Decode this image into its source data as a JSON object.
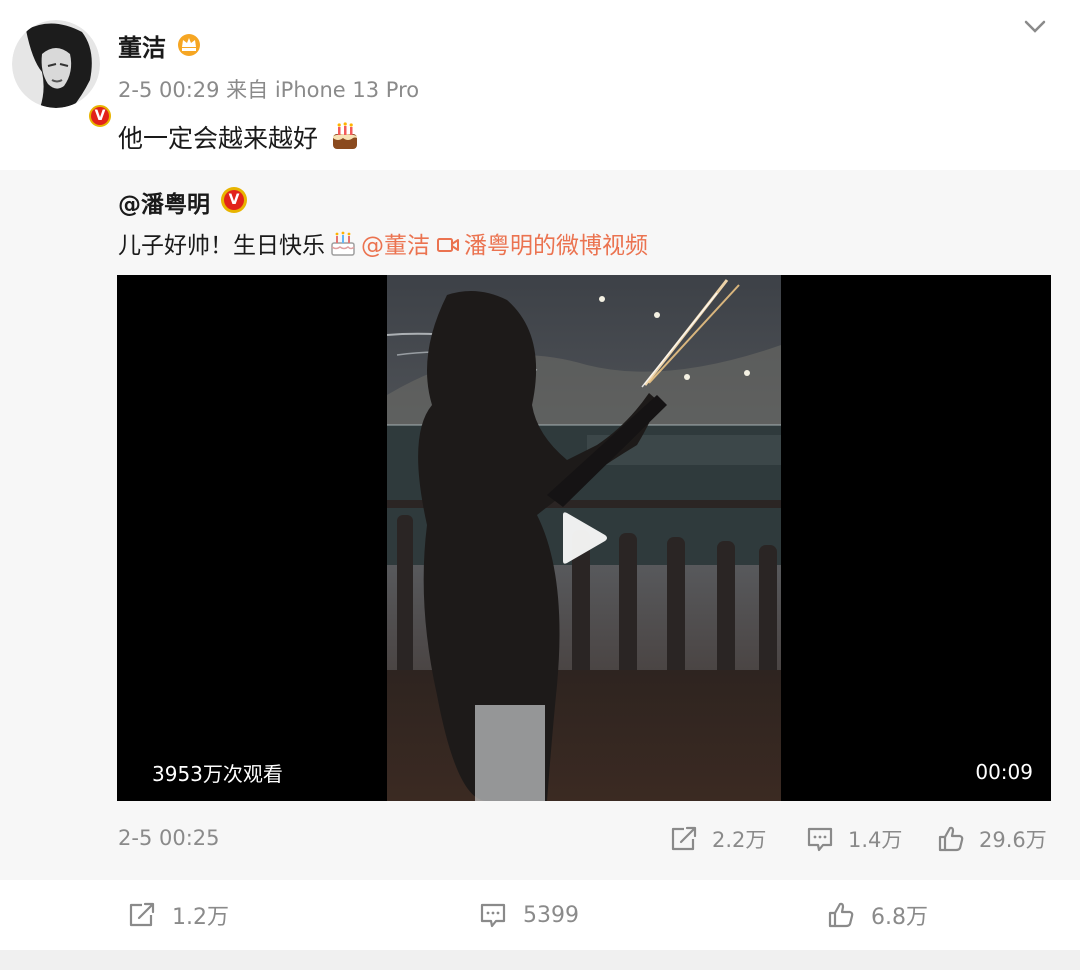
{
  "post": {
    "author": "董洁",
    "meta": "2-5 00:29  来自 iPhone 13 Pro",
    "text": "他一定会越来越好",
    "verified_mark": "V"
  },
  "repost": {
    "author": "@潘粤明",
    "verified_mark": "V",
    "text": "儿子好帅！生日快乐",
    "mention": "@董洁",
    "video_link": "潘粤明的微博视频",
    "video": {
      "views": "3953万次观看",
      "duration": "00:09"
    },
    "time": "2-5 00:25",
    "stats": {
      "shares": "2.2万",
      "comments": "1.4万",
      "likes": "29.6万"
    }
  },
  "actions": {
    "shares": "1.2万",
    "comments": "5399",
    "likes": "6.8万"
  },
  "colors": {
    "accent_link": "#eb7350",
    "muted_text": "#8a8a8a",
    "verified_red": "#e2231a",
    "repost_bg": "#f7f7f7"
  },
  "icons": [
    "avatar",
    "verified-badge-icon",
    "crown-icon",
    "chevron-down-icon",
    "cake-icon",
    "birthday-cake-icon",
    "video-link-icon",
    "play-icon",
    "share-icon",
    "comment-icon",
    "like-icon"
  ]
}
